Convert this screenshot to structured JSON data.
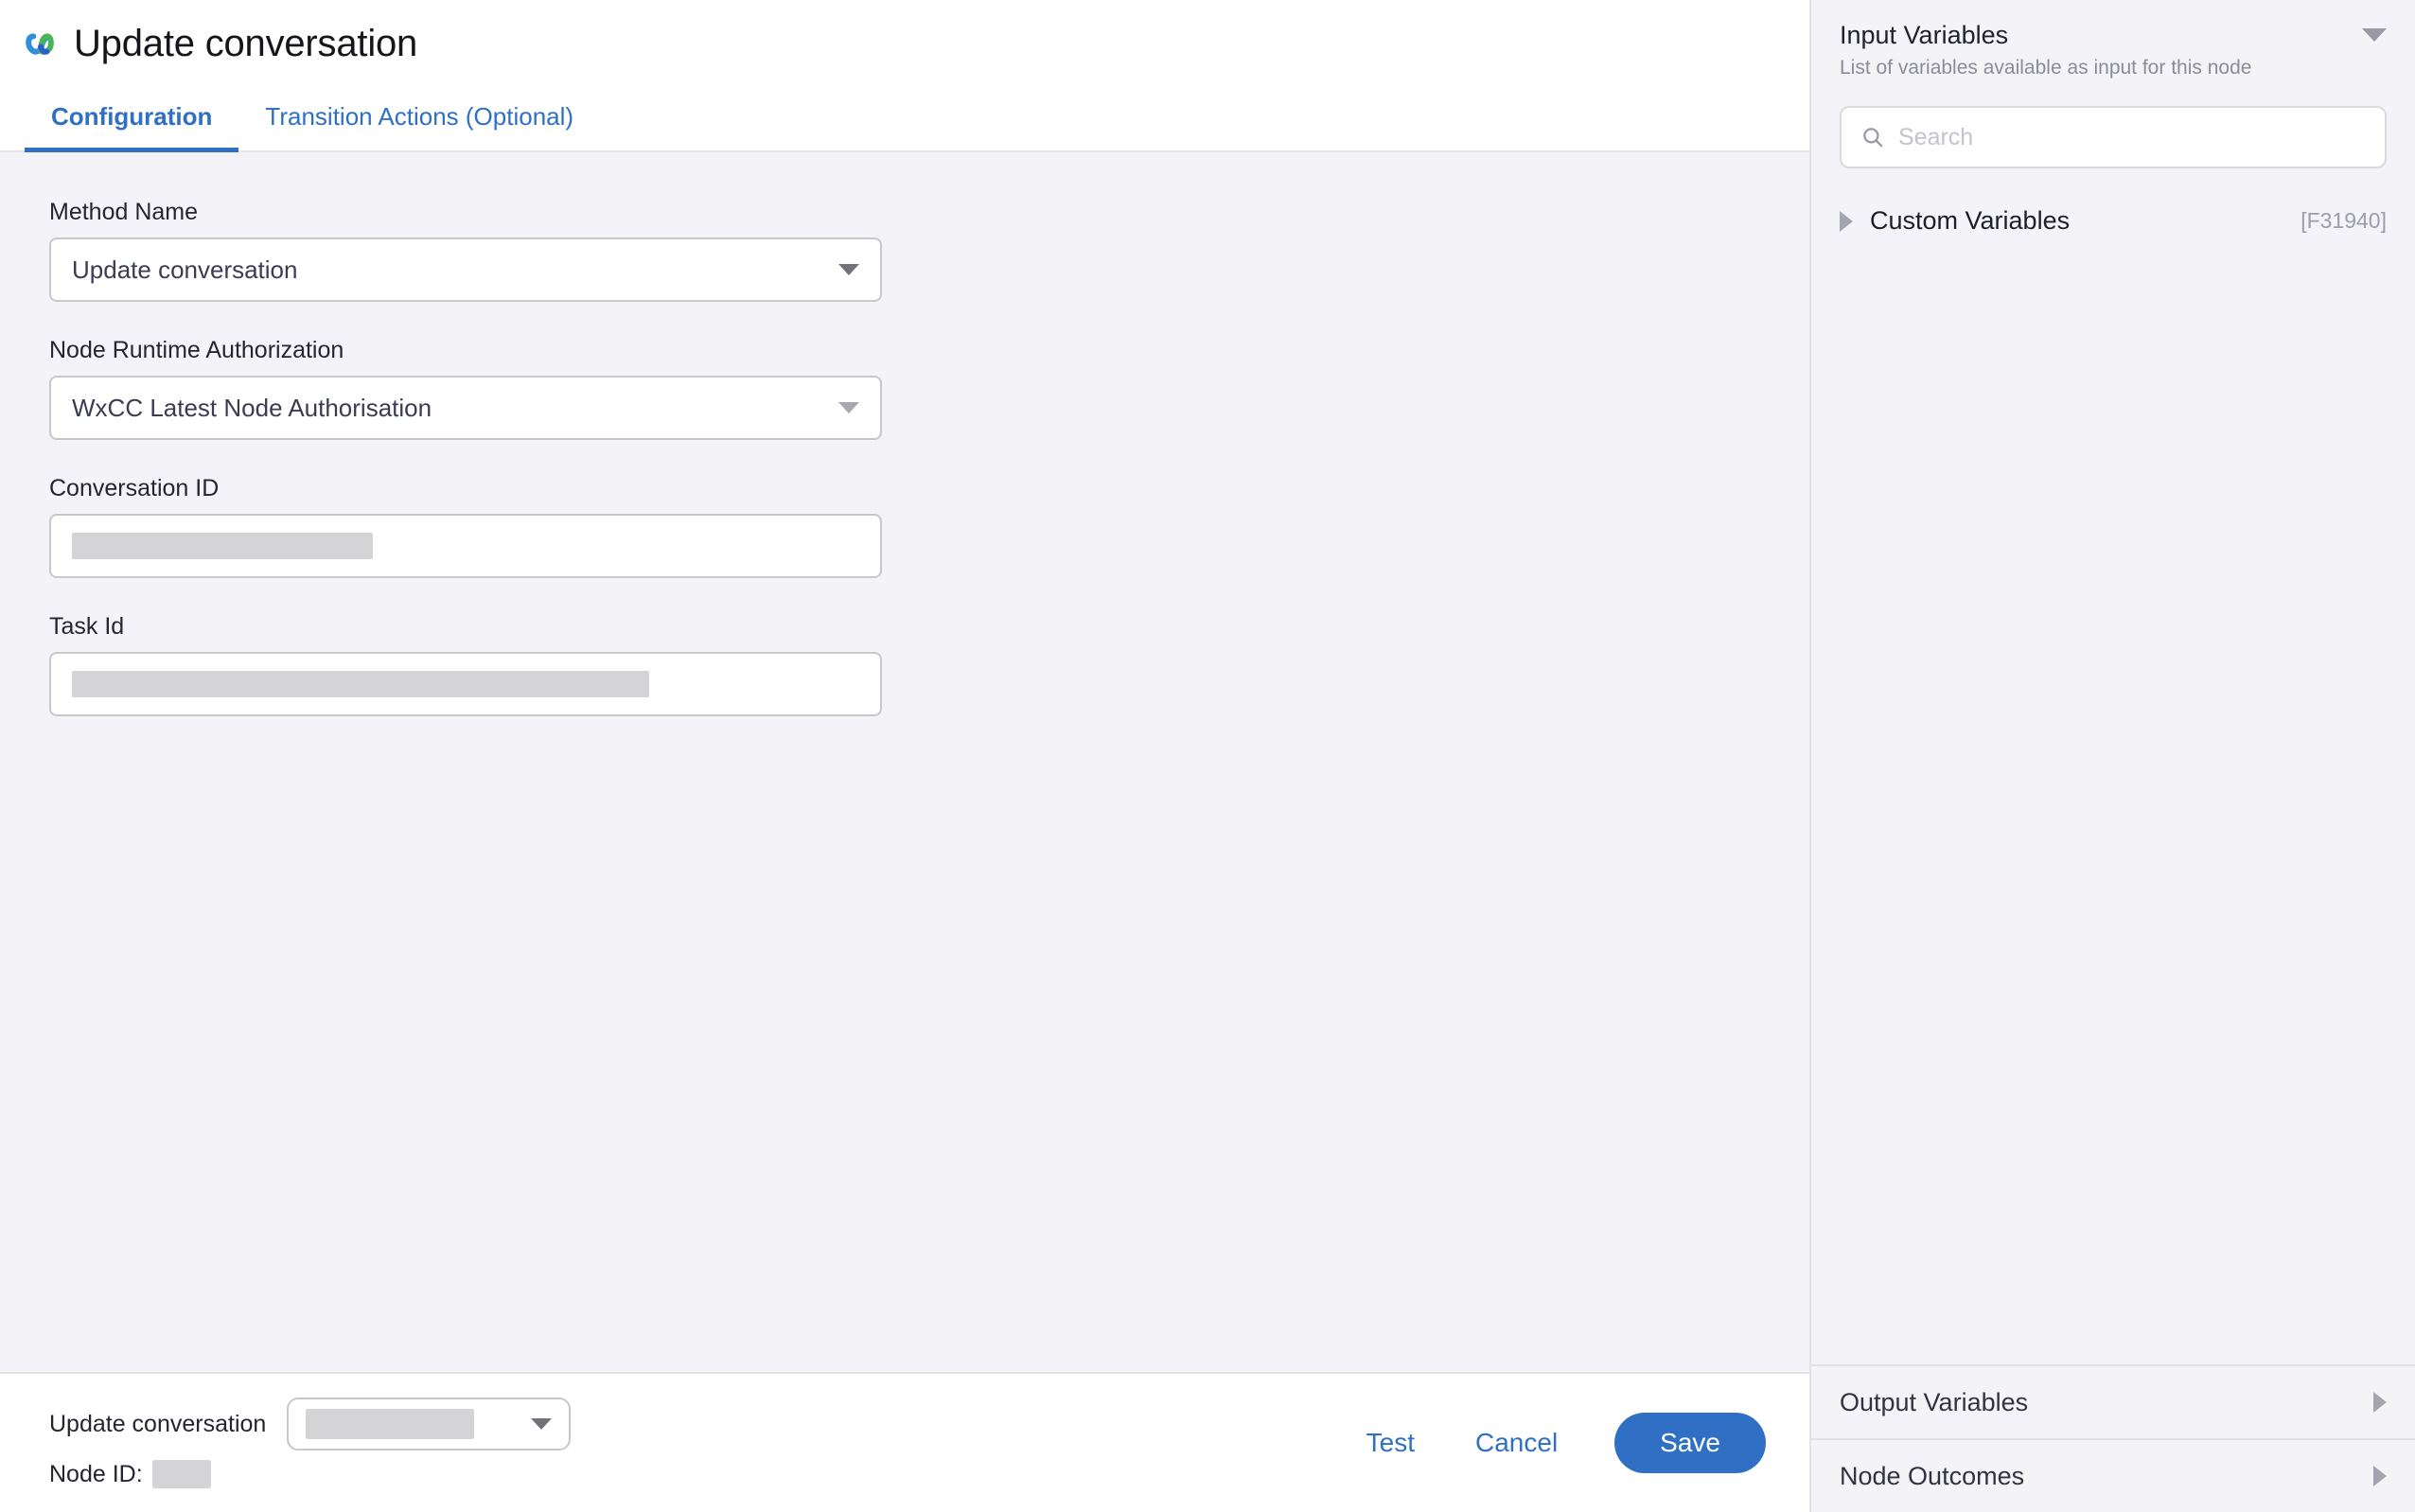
{
  "header": {
    "logo_icon": "webex-logo-icon",
    "title": "Update conversation"
  },
  "tabs": [
    {
      "label": "Configuration",
      "active": true
    },
    {
      "label": "Transition Actions (Optional)",
      "active": false
    }
  ],
  "form": {
    "method_name": {
      "label": "Method Name",
      "value": "Update conversation",
      "caret_icon": "chevron-down-icon"
    },
    "node_runtime_authorization": {
      "label": "Node Runtime Authorization",
      "value": "WxCC Latest Node Authorisation",
      "caret_icon": "chevron-down-icon"
    },
    "conversation_id": {
      "label": "Conversation ID",
      "value": "",
      "redacted": true
    },
    "task_id": {
      "label": "Task Id",
      "value": "",
      "redacted": true
    }
  },
  "footer": {
    "node_label": "Update conversation",
    "node_select_value": "",
    "node_select_caret_icon": "chevron-down-icon",
    "node_id_label": "Node ID:",
    "node_id_value": "",
    "test_label": "Test",
    "cancel_label": "Cancel",
    "save_label": "Save"
  },
  "sidebar": {
    "input_variables": {
      "title": "Input Variables",
      "subtitle": "List of variables available as input for this node",
      "collapse_icon": "chevron-down-icon",
      "search": {
        "placeholder": "Search",
        "icon": "search-icon",
        "value": ""
      },
      "groups": [
        {
          "name": "Custom Variables",
          "badge": "[F31940]",
          "expand_icon": "chevron-right-icon"
        }
      ]
    },
    "sections": [
      {
        "label": "Output Variables",
        "expand_icon": "chevron-right-icon"
      },
      {
        "label": "Node Outcomes",
        "expand_icon": "chevron-right-icon"
      }
    ]
  },
  "colors": {
    "accent_blue": "#2f6fc4",
    "background": "#f4f4f8",
    "panel_white": "#ffffff",
    "border": "#c7c7cc",
    "redacted_gray": "#d4d4d6"
  }
}
